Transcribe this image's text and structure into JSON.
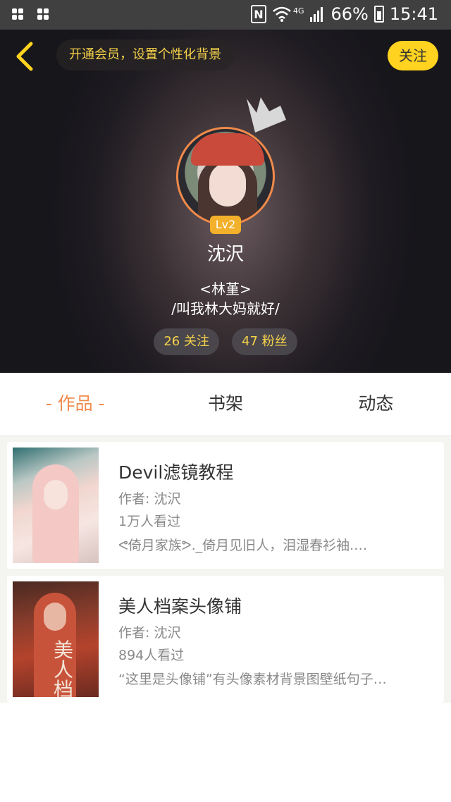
{
  "status_bar": {
    "network": "4G",
    "battery": "66%",
    "time": "15:41"
  },
  "header": {
    "vip_text": "开通会员，设置个性化背景",
    "follow_label": "关注",
    "level": "Lv2",
    "nickname": "沈沢",
    "signature_line1": "<林堇>",
    "signature_line2": "/叫我林大妈就好/",
    "following": "26 关注",
    "fans": "47 粉丝"
  },
  "tabs": [
    {
      "label": "- 作品 -",
      "active": true
    },
    {
      "label": "书架",
      "active": false
    },
    {
      "label": "动态",
      "active": false
    }
  ],
  "works": [
    {
      "title": "Devil滤镜教程",
      "author": "作者: 沈沢",
      "views": "1万人看过",
      "desc": "ᕙ倚月家族ᕗ._倚月见旧人，泪湿春衫袖.…"
    },
    {
      "title": "美人档案头像铺",
      "author": "作者: 沈沢",
      "views": "894人看过",
      "desc": "“这里是头像铺”有头像素材背景图壁纸句子…",
      "cover_text": "美人档案"
    }
  ],
  "colors": {
    "accent": "#f08a4b",
    "yellow": "#ffd31f",
    "gold_text": "#f5d24a"
  }
}
